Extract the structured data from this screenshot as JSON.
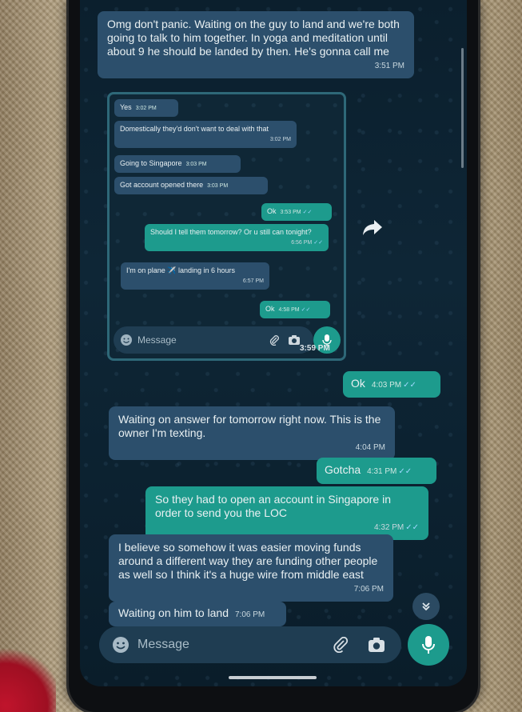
{
  "colors": {
    "incoming_bubble": "#2c4f6c",
    "outgoing_bubble": "#1d9b8d",
    "chat_background": "#0e2636",
    "read_check": "#9fd9ff"
  },
  "top_message": {
    "text": "Omg don't panic.  Waiting on the guy to land and we're both going to talk to him together.  In yoga and meditation until about 9 he should be landed by then.  He's gonna call me",
    "time": "3:51 PM"
  },
  "embedded_chat": {
    "messages": [
      {
        "dir": "in",
        "text": "Yes",
        "time": "3:02 PM"
      },
      {
        "dir": "in",
        "text": "Domestically they'd don't want to deal with that",
        "time": "3:02 PM"
      },
      {
        "dir": "in",
        "text": "Going to Singapore",
        "time": "3:03 PM"
      },
      {
        "dir": "in",
        "text": "Got account opened there",
        "time": "3:03 PM"
      },
      {
        "dir": "out",
        "text": "Ok",
        "time": "3:53 PM"
      },
      {
        "dir": "out",
        "text": "Should I tell them tomorrow? Or u still can tonight?",
        "time": "6:56 PM"
      },
      {
        "dir": "in",
        "text": "I'm on plane ✈️ landing in 6 hours",
        "time": "6:57 PM"
      },
      {
        "dir": "out",
        "text": "Ok",
        "time": "4:58 PM"
      }
    ],
    "input_placeholder": "Message",
    "screenshot_time": "3:59 PM",
    "icons": {
      "emoji": "emoji-icon",
      "attach": "paperclip-icon",
      "camera": "camera-icon",
      "mic": "mic-icon"
    }
  },
  "messages": [
    {
      "dir": "out",
      "text": "Ok",
      "time": "4:03 PM"
    },
    {
      "dir": "in",
      "text": "Waiting on answer for tomorrow right now.  This is the owner I'm texting.",
      "time": "4:04 PM"
    },
    {
      "dir": "out",
      "text": "Gotcha",
      "time": "4:31 PM"
    },
    {
      "dir": "out",
      "text": "So they had to open an account in Singapore in order to send you the LOC",
      "time": "4:32 PM"
    },
    {
      "dir": "in",
      "text": "I believe so somehow it was easier moving funds around a different way they are funding other people as well so I think it's a huge wire from middle east",
      "time": "7:06 PM"
    },
    {
      "dir": "in",
      "text": "Waiting on him to land",
      "time": "7:06 PM"
    }
  ],
  "input": {
    "placeholder": "Message"
  },
  "icons": {
    "forward": "forward-icon",
    "scroll_down": "chevron-double-down-icon",
    "emoji": "emoji-icon",
    "attach": "paperclip-icon",
    "camera": "camera-icon",
    "mic": "mic-icon"
  }
}
